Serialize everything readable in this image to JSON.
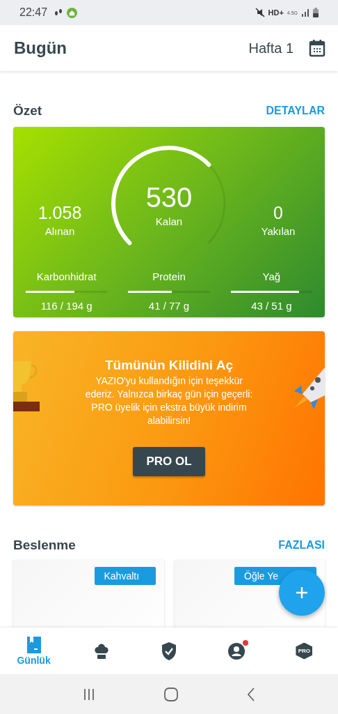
{
  "status_bar": {
    "time": "22:47",
    "network": "HD+",
    "generation": "4.5G"
  },
  "header": {
    "title": "Bugün",
    "week": "Hafta 1"
  },
  "summary": {
    "title": "Özet",
    "link": "DETAYLAR",
    "gauge": {
      "value": "530",
      "label": "Kalan"
    },
    "stats": [
      {
        "value": "1.058",
        "label": "Alınan"
      },
      {
        "value": "0",
        "label": "Yakılan"
      }
    ],
    "macros": [
      {
        "name": "Karbonhidrat",
        "reading": "116 / 194 g",
        "level": 0.6
      },
      {
        "name": "Protein",
        "reading": "41 / 77 g",
        "level": 0.53
      },
      {
        "name": "Yağ",
        "reading": "43 / 51 g",
        "level": 0.84
      }
    ]
  },
  "promo": {
    "title": "Tümünün Kilidini Aç",
    "text": "YAZIO'yu kullandığın için teşekkür ederiz. Yalnızca birkaç gün için geçerli: PRO üyelik için ekstra büyük indirim alabilirsin!",
    "button": "PRO OL"
  },
  "nutrition": {
    "title": "Beslenme",
    "link": "FAZLASI",
    "meals": [
      {
        "label": "Kahvaltı"
      },
      {
        "label": "Öğle Ye"
      }
    ]
  },
  "bottom_nav": [
    {
      "kind": "diary",
      "label": "Günlük",
      "selected": true
    },
    {
      "kind": "recipes",
      "selected": false
    },
    {
      "kind": "goals",
      "selected": false
    },
    {
      "kind": "profile",
      "selected": false,
      "badge": true
    },
    {
      "kind": "pro",
      "text": "PRO",
      "selected": false
    }
  ]
}
